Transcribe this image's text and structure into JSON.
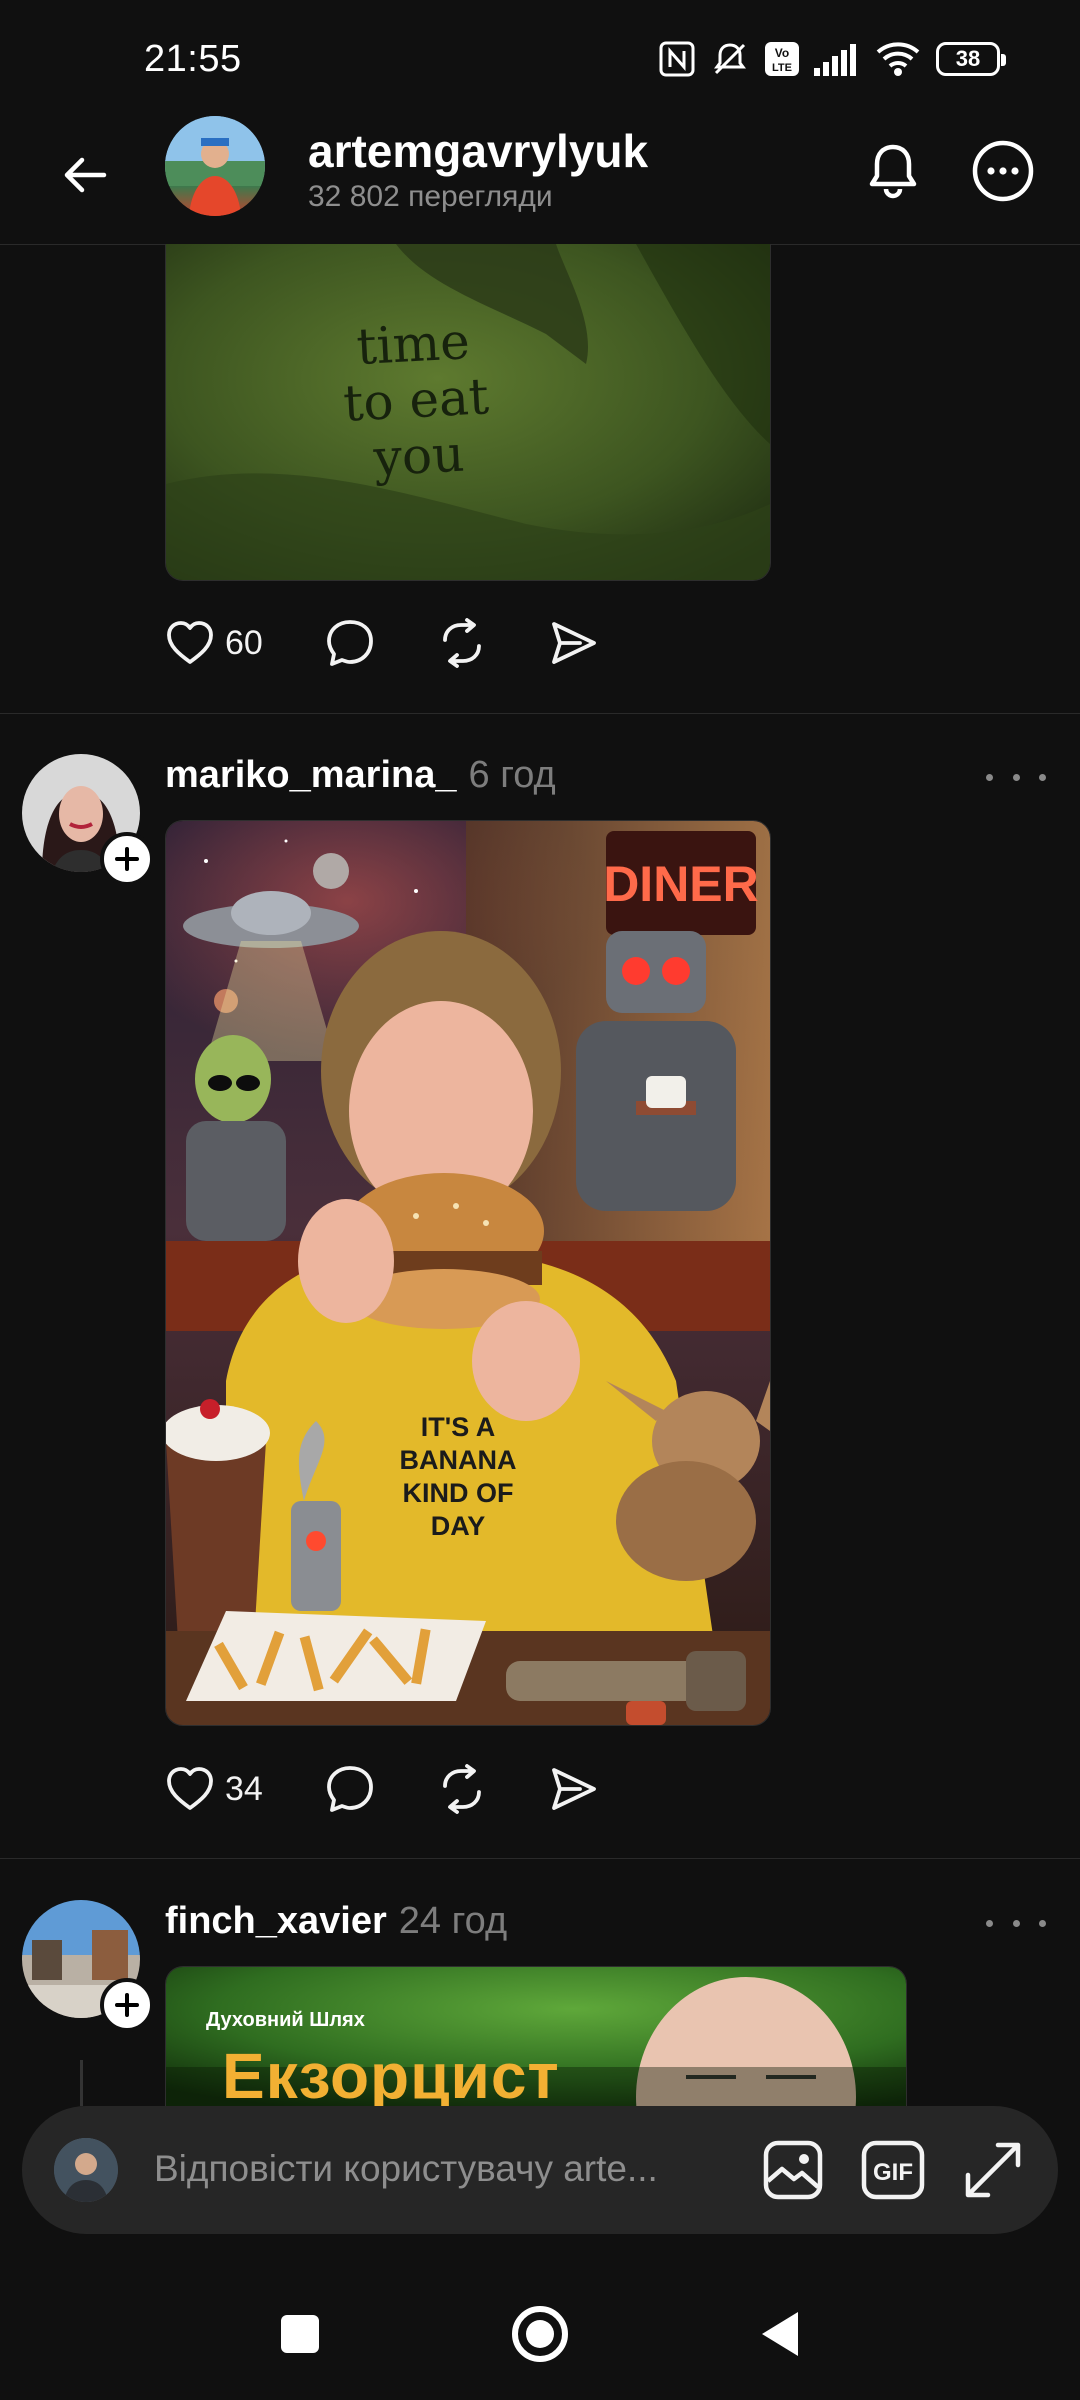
{
  "status_bar": {
    "time": "21:55",
    "battery": "38"
  },
  "header": {
    "username": "artemgavrylyuk",
    "views": "32 802 перегляди"
  },
  "posts": [
    {
      "image_text": "time\nto eat\nyou",
      "likes": "60"
    },
    {
      "username": "mariko_marina_",
      "time": "6 год",
      "likes": "34",
      "image_text": {
        "sign": "DINER",
        "shirt": "IT'S A BANANA KIND OF DAY"
      }
    },
    {
      "username": "finch_xavier",
      "time": "24 год",
      "image_text": {
        "caption": "Духовний Шлях",
        "title": "Екзорцист"
      }
    }
  ],
  "reply_bar": {
    "placeholder": "Відповісти користувачу arte..."
  },
  "icons": {
    "back": "arrow-left-icon",
    "notifications": "bell-icon",
    "more": "more-circle-icon",
    "like": "heart-icon",
    "comment": "comment-icon",
    "repost": "repost-icon",
    "share": "send-icon",
    "gallery": "image-icon",
    "gif": "gif-icon",
    "expand": "expand-icon",
    "nav_recents": "square-icon",
    "nav_home": "circle-icon",
    "nav_back": "triangle-back-icon"
  },
  "colors": {
    "background": "#101010",
    "text_primary": "#f3f3f3",
    "text_secondary": "#8e8e8e",
    "reply_bar": "#262626"
  }
}
